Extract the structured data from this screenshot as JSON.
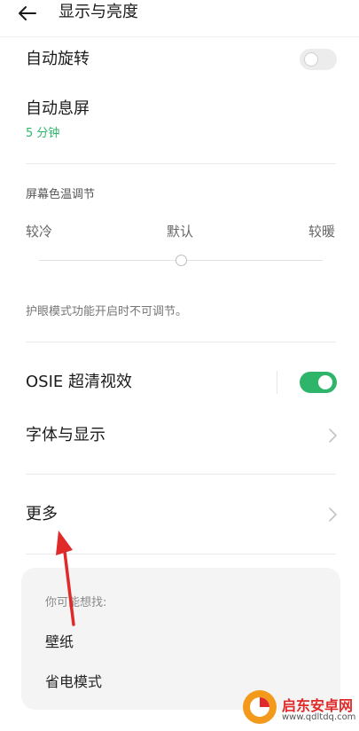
{
  "header": {
    "title": "显示与亮度",
    "back_icon": "arrow-left-icon"
  },
  "auto_rotate": {
    "label": "自动旋转",
    "enabled": false
  },
  "screen_timeout": {
    "label": "自动息屏",
    "value": "5 分钟"
  },
  "color_temp": {
    "title": "屏幕色温调节",
    "cold": "较冷",
    "default": "默认",
    "warm": "较暖",
    "level": 0.5,
    "note": "护眼模式功能开启时不可调节。"
  },
  "osie": {
    "label": "OSIE 超清视效",
    "enabled": true
  },
  "font_display": {
    "label": "字体与显示"
  },
  "more": {
    "label": "更多"
  },
  "suggestions": {
    "title": "你可能想找:",
    "items": [
      "壁纸",
      "省电模式"
    ]
  },
  "watermark": {
    "brand": "启东安卓网",
    "url": "www.qdltdq.com"
  },
  "colors": {
    "accent": "#2fb56a",
    "arrow": "#e02a2a",
    "watermark_orange": "#f39a1c"
  }
}
